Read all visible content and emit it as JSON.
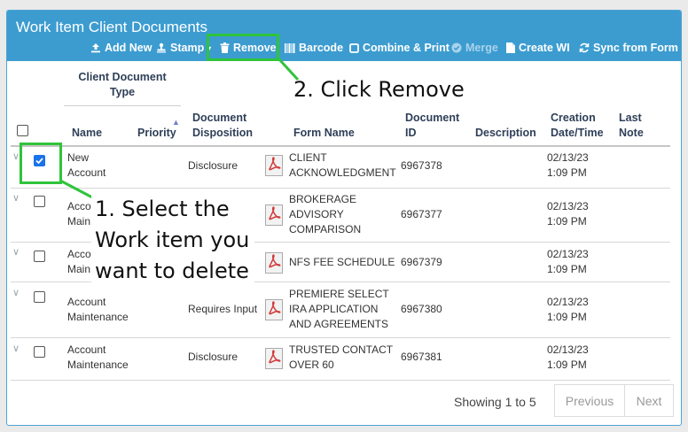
{
  "panel": {
    "title": "Work Item Client Documents"
  },
  "toolbar": {
    "add_new": "Add New",
    "stamp": "Stamp",
    "remove": "Remove",
    "barcode": "Barcode",
    "combine_print": "Combine & Print",
    "merge": "Merge",
    "create_wi": "Create WI",
    "sync_from_form": "Sync from Form"
  },
  "annotations": {
    "step2": "2. Click Remove",
    "step1_line1": "1. Select the",
    "step1_line2": "Work item you",
    "step1_line3": "want to delete"
  },
  "table": {
    "group_header": {
      "line1": "Client Document",
      "line2": "Type"
    },
    "columns": {
      "name": "Name",
      "priority": "Priority",
      "disposition": {
        "line1": "Document",
        "line2": "Disposition"
      },
      "form_name": "Form Name",
      "document_id": {
        "line1": "Document",
        "line2": "ID"
      },
      "description": "Description",
      "created": {
        "line1": "Creation",
        "line2": "Date/Time"
      },
      "last_note": {
        "line1": "Last",
        "line2": "Note"
      }
    },
    "rows": [
      {
        "name1": "New",
        "name2": "Account",
        "disposition": "Disclosure",
        "form1": "CLIENT",
        "form2": "ACKNOWLEDGMENT",
        "form3": "",
        "doc_id": "6967378",
        "date": "02/13/23",
        "time": "1:09 PM",
        "checked": true
      },
      {
        "name1": "Acco",
        "name2": "Main",
        "disposition": "",
        "form1": "BROKERAGE",
        "form2": "ADVISORY",
        "form3": "COMPARISON",
        "doc_id": "6967377",
        "date": "02/13/23",
        "time": "1:09 PM",
        "checked": false
      },
      {
        "name1": "Acco",
        "name2": "Main",
        "disposition": "",
        "form1": "NFS FEE SCHEDULE",
        "form2": "",
        "form3": "",
        "doc_id": "6967379",
        "date": "02/13/23",
        "time": "1:09 PM",
        "checked": false
      },
      {
        "name1": "Account",
        "name2": "Maintenance",
        "disposition": "Requires Input",
        "form1": "PREMIERE SELECT",
        "form2": "IRA APPLICATION",
        "form3": "AND AGREEMENTS",
        "doc_id": "6967380",
        "date": "02/13/23",
        "time": "1:09 PM",
        "checked": false
      },
      {
        "name1": "Account",
        "name2": "Maintenance",
        "disposition": "Disclosure",
        "form1": "TRUSTED CONTACT",
        "form2": "OVER 60",
        "form3": "",
        "doc_id": "6967381",
        "date": "02/13/23",
        "time": "1:09 PM",
        "checked": false
      }
    ]
  },
  "pager": {
    "info": "Showing 1 to 5",
    "previous": "Previous",
    "next": "Next"
  },
  "colors": {
    "header": "#3c9cd0",
    "highlight": "#2fc43b"
  }
}
